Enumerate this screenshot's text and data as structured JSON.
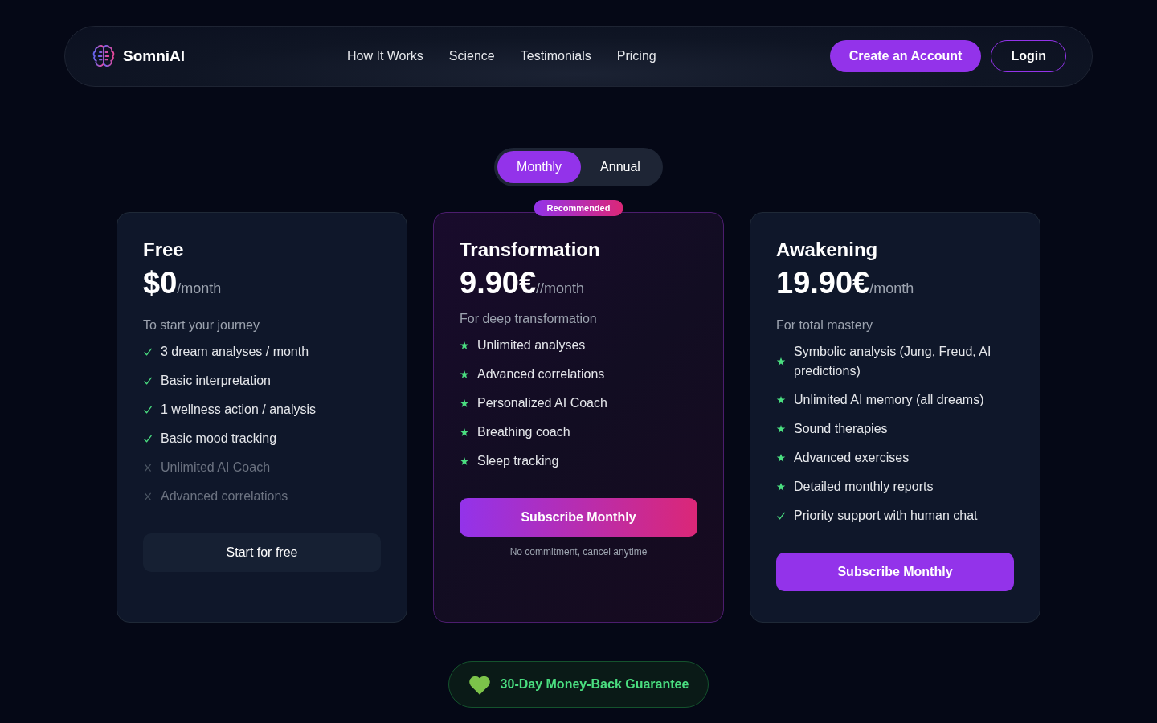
{
  "nav": {
    "brand": "SomniAI",
    "links": [
      "How It Works",
      "Science",
      "Testimonials",
      "Pricing"
    ],
    "actions": [
      {
        "label": "Create an Account",
        "kind": "solid"
      },
      {
        "label": "Login",
        "kind": "outline"
      }
    ]
  },
  "billing_toggle": [
    {
      "label": "Monthly",
      "selected": true
    },
    {
      "label": "Annual",
      "selected": false
    }
  ],
  "plans": [
    {
      "name": "Free",
      "price": "$0",
      "period": "/month",
      "description": "To start your journey",
      "featured": false,
      "features": [
        {
          "text": "3 dream analyses / month",
          "kind": "check"
        },
        {
          "text": "Basic interpretation",
          "kind": "check"
        },
        {
          "text": "1 wellness action / analysis",
          "kind": "check"
        },
        {
          "text": "Basic mood tracking",
          "kind": "check"
        },
        {
          "text": "Unlimited AI Coach",
          "kind": "cross"
        },
        {
          "text": "Advanced correlations",
          "kind": "cross"
        }
      ],
      "button": {
        "label": "Start for free",
        "kind": "plain"
      }
    },
    {
      "name": "Transformation",
      "badge": "Recommended",
      "price": "9.90€",
      "period": "//month",
      "description": "For deep transformation",
      "featured": true,
      "features": [
        {
          "text": "Unlimited analyses",
          "kind": "star"
        },
        {
          "text": "Advanced correlations",
          "kind": "star"
        },
        {
          "text": "Personalized AI Coach",
          "kind": "star"
        },
        {
          "text": "Breathing coach",
          "kind": "star"
        },
        {
          "text": "Sleep tracking",
          "kind": "star"
        }
      ],
      "button": {
        "label": "Subscribe Monthly",
        "kind": "gradient"
      },
      "note": "No commitment, cancel anytime"
    },
    {
      "name": "Awakening",
      "price": "19.90€",
      "period": "/month",
      "description": "For total mastery",
      "featured": false,
      "features": [
        {
          "text": "Symbolic analysis (Jung, Freud, AI predictions)",
          "kind": "star"
        },
        {
          "text": "Unlimited AI memory (all dreams)",
          "kind": "star"
        },
        {
          "text": "Sound therapies",
          "kind": "star"
        },
        {
          "text": "Advanced exercises",
          "kind": "star"
        },
        {
          "text": "Detailed monthly reports",
          "kind": "star"
        },
        {
          "text": "Priority support with human chat",
          "kind": "check"
        }
      ],
      "button": {
        "label": "Subscribe Monthly",
        "kind": "solid"
      }
    }
  ],
  "guarantee": "30-Day Money-Back Guarantee"
}
